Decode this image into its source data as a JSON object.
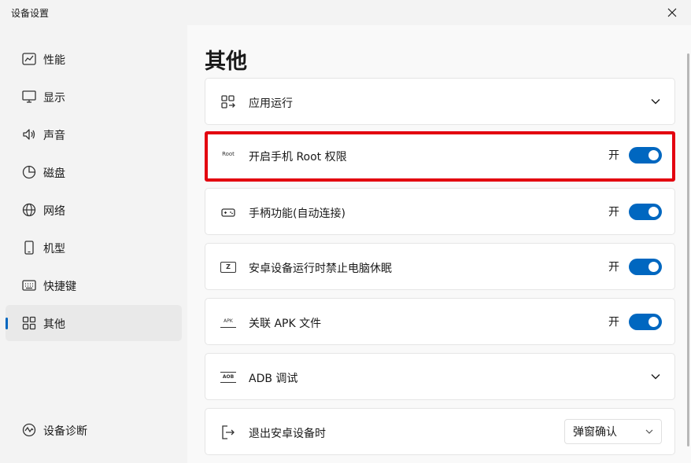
{
  "window": {
    "title": "设备设置"
  },
  "sidebar": {
    "items": [
      {
        "label": "性能",
        "icon": "performance-chart-icon"
      },
      {
        "label": "显示",
        "icon": "monitor-icon"
      },
      {
        "label": "声音",
        "icon": "speaker-icon"
      },
      {
        "label": "磁盘",
        "icon": "disk-pie-icon"
      },
      {
        "label": "网络",
        "icon": "globe-icon"
      },
      {
        "label": "机型",
        "icon": "phone-icon"
      },
      {
        "label": "快捷键",
        "icon": "keyboard-icon"
      },
      {
        "label": "其他",
        "icon": "apps-grid-icon",
        "active": true
      }
    ],
    "footer": {
      "label": "设备诊断",
      "icon": "diagnosis-icon"
    }
  },
  "main": {
    "title": "其他",
    "settings": [
      {
        "label": "应用运行",
        "icon": "app-run-icon",
        "control": "expand"
      },
      {
        "label": "开启手机 Root 权限",
        "icon_text": "Root",
        "control": "toggle",
        "state_text": "开",
        "on": true,
        "highlighted": true
      },
      {
        "label": "手柄功能(自动连接)",
        "icon": "gamepad-icon",
        "control": "toggle",
        "state_text": "开",
        "on": true
      },
      {
        "label": "安卓设备运行时禁止电脑休眠",
        "icon_text": "Z",
        "control": "toggle",
        "state_text": "开",
        "on": true
      },
      {
        "label": "关联 APK 文件",
        "icon_text": "APK",
        "control": "toggle",
        "state_text": "开",
        "on": true
      },
      {
        "label": "ADB 调试",
        "icon_text": "AOB",
        "control": "expand"
      },
      {
        "label": "退出安卓设备时",
        "icon": "exit-icon",
        "control": "select",
        "value": "弹窗确认"
      }
    ]
  },
  "colors": {
    "accent": "#0067c0",
    "highlight_border": "#e3000f"
  }
}
